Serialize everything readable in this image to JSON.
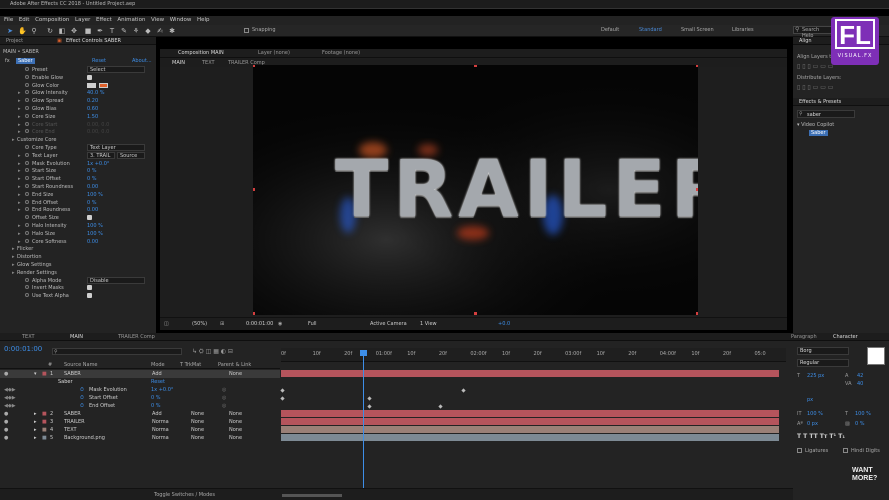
{
  "window": {
    "title": "Adobe After Effects CC 2018 - Untitled Project.aep"
  },
  "menu": [
    "File",
    "Edit",
    "Composition",
    "Layer",
    "Effect",
    "Animation",
    "View",
    "Window",
    "Help"
  ],
  "toolbar": {
    "snapping": "Snapping",
    "workspaces": [
      "Default",
      "Standard",
      "Small Screen",
      "Libraries"
    ],
    "active_workspace": "Standard",
    "search_placeholder": "Search Help"
  },
  "project_panel": {
    "tabs": [
      "Project",
      "Effect Controls SABER"
    ],
    "breadcrumb": "MAIN • SABER",
    "effect_name": "Saber",
    "reset": "Reset",
    "about": "About..."
  },
  "effect_controls": [
    {
      "label": "Preset",
      "value": "Select",
      "kind": "dropdown"
    },
    {
      "label": "Enable Glow",
      "kind": "check"
    },
    {
      "label": "Glow Color",
      "kind": "color"
    },
    {
      "label": "Glow Intensity",
      "value": "40.0 %"
    },
    {
      "label": "Glow Spread",
      "value": "0.20"
    },
    {
      "label": "Glow Bias",
      "value": "0.60"
    },
    {
      "label": "Core Size",
      "value": "1.50"
    },
    {
      "label": "Core Start",
      "value": "0.00, 0.0",
      "dim": true
    },
    {
      "label": "Core End",
      "value": "0.00, 0.0",
      "dim": true
    },
    {
      "label": "Customize Core",
      "kind": "group"
    },
    {
      "label": "Core Type",
      "value": "Text Layer",
      "kind": "dropdown"
    },
    {
      "label": "Text Layer",
      "value": "3. TRAIL",
      "value2": "Source",
      "kind": "dropdown2"
    },
    {
      "label": "Mask Evolution",
      "value": "1x +0.0°"
    },
    {
      "label": "Start Size",
      "value": "0 %"
    },
    {
      "label": "Start Offset",
      "value": "0 %"
    },
    {
      "label": "Start Roundness",
      "value": "0.00"
    },
    {
      "label": "End Size",
      "value": "100 %"
    },
    {
      "label": "End Offset",
      "value": "0 %"
    },
    {
      "label": "End Roundness",
      "value": "0.00"
    },
    {
      "label": "Offset Size",
      "kind": "check"
    },
    {
      "label": "Halo Intensity",
      "value": "100 %"
    },
    {
      "label": "Halo Size",
      "value": "100 %"
    },
    {
      "label": "Core Softness",
      "value": "0.00"
    },
    {
      "label": "Flicker",
      "kind": "group"
    },
    {
      "label": "Distortion",
      "kind": "group"
    },
    {
      "label": "Glow Settings",
      "kind": "group"
    },
    {
      "label": "Render Settings",
      "kind": "group"
    },
    {
      "label": "Alpha Mode",
      "value": "Disable",
      "kind": "dropdown"
    },
    {
      "label": "Invert Masks",
      "kind": "check"
    },
    {
      "label": "Use Text Alpha",
      "kind": "check"
    }
  ],
  "composition": {
    "tabs": [
      "Composition MAIN",
      "Layer (none)",
      "Footage (none)"
    ],
    "flow": [
      "MAIN",
      "TEXT",
      "TRAILER Comp"
    ],
    "title_text": "TRAILER",
    "footer": {
      "zoom": "(50%)",
      "timecode": "0:00:01:00",
      "resolution": "Full",
      "camera": "Active Camera",
      "view": "1 View",
      "exposure": "+0.0"
    }
  },
  "right_panel": {
    "align_tab": "Align",
    "align_layers_to": "Align Layers to:",
    "distribute": "Distribute Layers:",
    "effects_tab": "Effects & Presets",
    "search_value": "saber",
    "tree_folder": "Video Copilot",
    "tree_item": "Saber"
  },
  "timeline": {
    "tabs": [
      "TEXT",
      "MAIN",
      "TRAILER Comp"
    ],
    "timecode": "0:00:01:00",
    "columns": [
      "#",
      "Source Name",
      "Mode",
      "T TrkMat",
      "Parent & Link"
    ],
    "ruler": [
      "0f",
      "10f",
      "20f",
      "01:00f",
      "10f",
      "20f",
      "02:00f",
      "10f",
      "20f",
      "03:00f",
      "10f",
      "20f",
      "04:00f",
      "10f",
      "20f",
      "05:0"
    ],
    "layers": [
      {
        "num": "1",
        "name": "SABER",
        "mode": "Add",
        "trkmat": "",
        "parent": "None"
      },
      {
        "num": "2",
        "name": "SABER",
        "mode": "Add",
        "trkmat": "None",
        "parent": "None"
      },
      {
        "num": "3",
        "name": "TRAILER",
        "mode": "Norma",
        "trkmat": "None",
        "parent": "None"
      },
      {
        "num": "4",
        "name": "TEXT",
        "mode": "Norma",
        "trkmat": "None",
        "parent": "None"
      },
      {
        "num": "5",
        "name": "Background.png",
        "mode": "Norma",
        "trkmat": "None",
        "parent": "None"
      }
    ],
    "sub_effect": "Saber",
    "sub_reset": "Reset",
    "sub_props": [
      {
        "name": "Mask Evolution",
        "value": "1x +0.0°"
      },
      {
        "name": "Start Offset",
        "value": "0 %"
      },
      {
        "name": "End Offset",
        "value": "0 %"
      }
    ],
    "footer": "Toggle Switches / Modes"
  },
  "character_panel": {
    "tabs": [
      "Paragraph",
      "Character"
    ],
    "font": "Borg",
    "style": "Regular",
    "size": "225 px",
    "leading": "42",
    "tracking": "40",
    "px_unit": "px",
    "vscale": "100 %",
    "hscale": "100 %",
    "baseline": "0 px",
    "tsume": "0 %",
    "ligatures": "Ligatures",
    "hindi": "Hindi Digits"
  },
  "watermark": {
    "logo": "FL",
    "logo_sub": "VISUAL.FX",
    "corner": [
      "WANT",
      "MORE?"
    ]
  }
}
